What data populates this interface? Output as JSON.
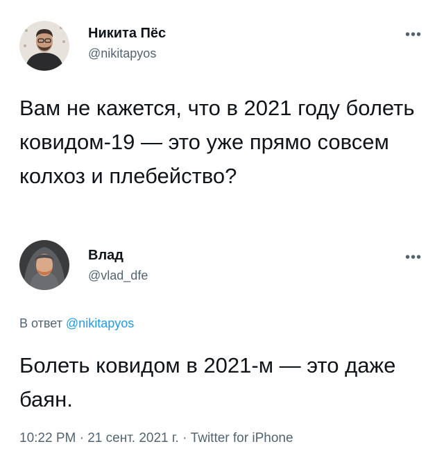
{
  "tweet": {
    "author": {
      "display_name": "Никита Пёс",
      "handle": "@nikitapyos"
    },
    "more_icon": "more-horizontal-icon",
    "text": "Вам не кажется, что в 2021 году болеть ковидом-19 — это уже прямо совсем колхоз и плебейство?"
  },
  "reply": {
    "author": {
      "display_name": "Влад",
      "handle": "@vlad_dfe"
    },
    "more_icon": "more-horizontal-icon",
    "replying_to_prefix": "В ответ",
    "replying_to_handle": "@nikitapyos",
    "text": "Болеть ковидом в 2021-м — это даже баян.",
    "meta": {
      "time": "10:22 PM",
      "separator": "·",
      "date": "21 сент. 2021 г.",
      "source": "Twitter for iPhone"
    }
  },
  "colors": {
    "text_primary": "#0f1419",
    "text_secondary": "#536471",
    "link": "#1d9bf0"
  }
}
